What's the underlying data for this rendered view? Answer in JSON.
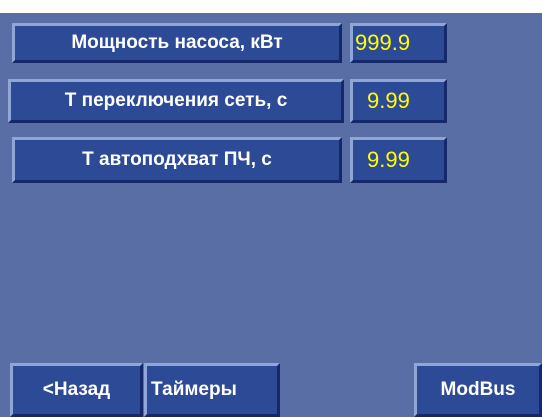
{
  "parameters": [
    {
      "label": "Мощность насоса, кВт",
      "value": "999.9"
    },
    {
      "label": "Т переключения сеть, с",
      "value": "9.99"
    },
    {
      "label": "Т автоподхват ПЧ, с",
      "value": "9.99"
    }
  ],
  "buttons": {
    "back": "<Назад",
    "timers": "Таймеры",
    "modbus": "ModBus"
  }
}
